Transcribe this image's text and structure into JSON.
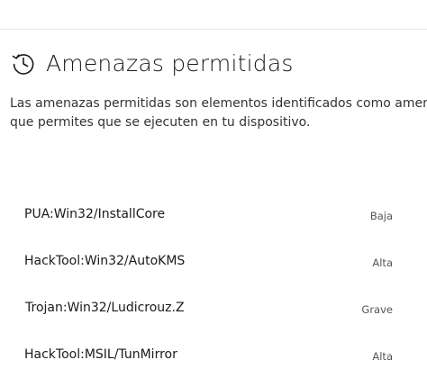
{
  "header": {
    "icon": "history-icon",
    "title": "Amenazas permitidas"
  },
  "description": {
    "line1": "Las amenazas permitidas son elementos identificados como amenazas",
    "line2": "que permites que se ejecuten en tu dispositivo."
  },
  "threats": [
    {
      "name": "PUA:Win32/InstallCore",
      "severity": "Baja"
    },
    {
      "name": "HackTool:Win32/AutoKMS",
      "severity": "Alta"
    },
    {
      "name": "Trojan:Win32/Ludicrouz.Z",
      "severity": "Grave"
    },
    {
      "name": "HackTool:MSIL/TunMirror",
      "severity": "Alta"
    }
  ]
}
